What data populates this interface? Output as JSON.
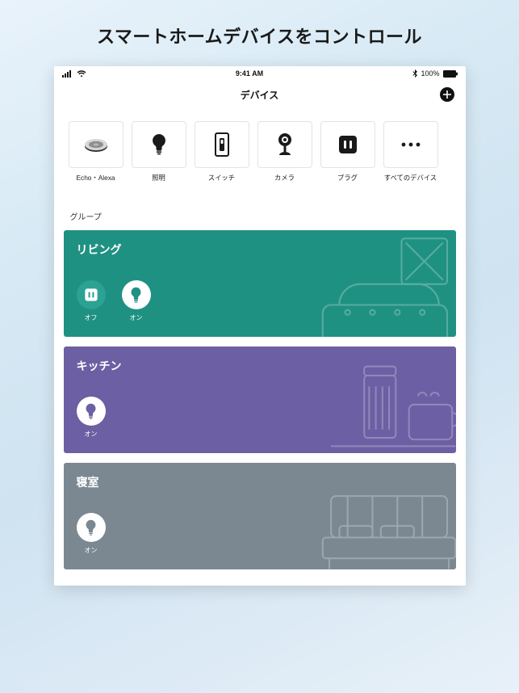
{
  "promo": {
    "heading": "スマートホームデバイスをコントロール"
  },
  "statusbar": {
    "time": "9:41 AM",
    "battery": "100%"
  },
  "header": {
    "title": "デバイス"
  },
  "categories": [
    {
      "id": "echo",
      "label": "Echo・Alexa"
    },
    {
      "id": "light",
      "label": "照明"
    },
    {
      "id": "switch",
      "label": "スイッチ"
    },
    {
      "id": "camera",
      "label": "カメラ"
    },
    {
      "id": "plug",
      "label": "プラグ"
    },
    {
      "id": "all",
      "label": "すべてのデバイス"
    }
  ],
  "section": {
    "groups_label": "グループ"
  },
  "groups": [
    {
      "id": "living",
      "title": "リビング",
      "color": "teal",
      "controls": [
        {
          "icon": "plug",
          "state": "off",
          "label": "オフ"
        },
        {
          "icon": "light",
          "state": "on",
          "label": "オン"
        }
      ]
    },
    {
      "id": "kitchen",
      "title": "キッチン",
      "color": "purple",
      "controls": [
        {
          "icon": "light",
          "state": "on",
          "label": "オン"
        }
      ]
    },
    {
      "id": "bedroom",
      "title": "寝室",
      "color": "gray",
      "controls": [
        {
          "icon": "light",
          "state": "on",
          "label": "オン"
        }
      ]
    }
  ]
}
